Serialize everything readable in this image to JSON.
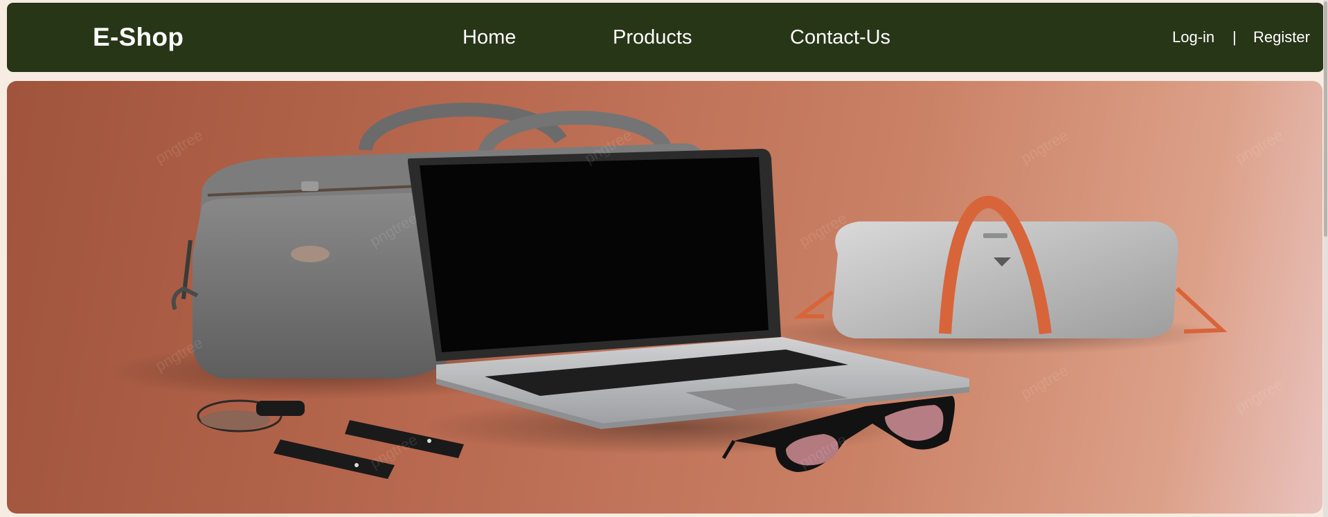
{
  "navbar": {
    "brand": "E-Shop",
    "links": [
      {
        "label": "Home"
      },
      {
        "label": "Products"
      },
      {
        "label": "Contact-Us"
      }
    ],
    "auth": {
      "login": "Log-in",
      "separator": "|",
      "register": "Register"
    }
  },
  "hero": {
    "watermark": "pngtree"
  },
  "colors": {
    "navbar_bg": "#283618",
    "page_bg": "#f6ece2",
    "nav_text": "#ffffff"
  }
}
